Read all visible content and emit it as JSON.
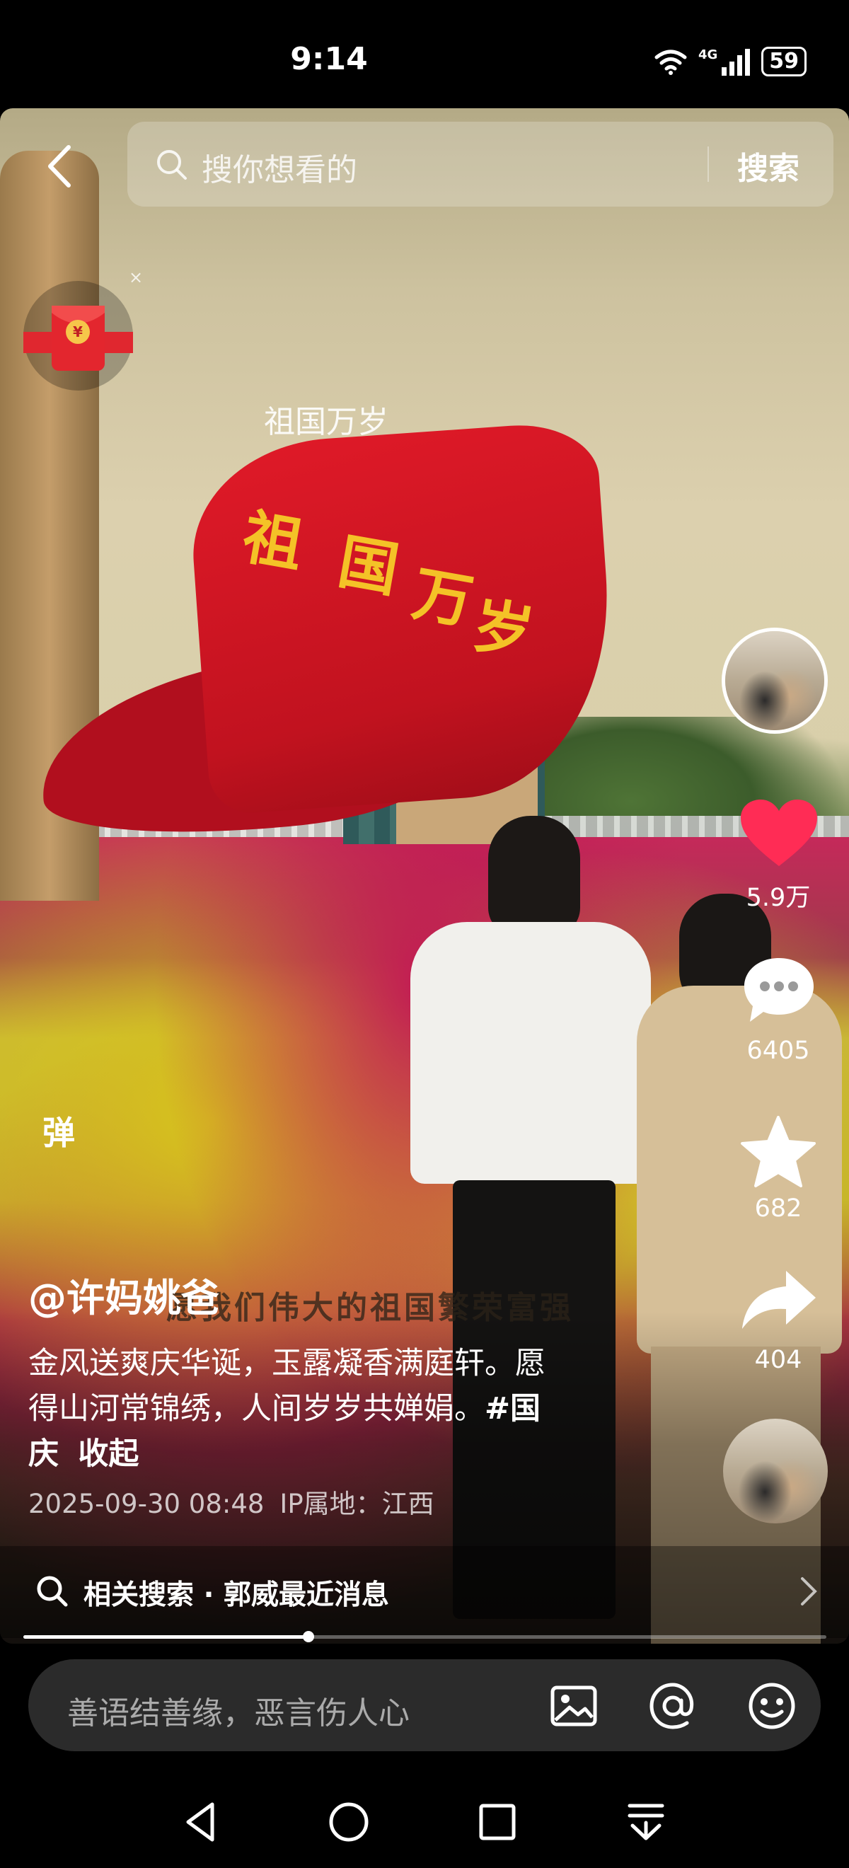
{
  "status_bar": {
    "time": "9:14",
    "network": "4G",
    "battery": "59"
  },
  "search": {
    "placeholder": "搜你想看的",
    "button_label": "搜索"
  },
  "video": {
    "danmaku_text": "祖国万岁",
    "flag_text": [
      "祖",
      "国",
      "万",
      "岁"
    ],
    "subtitle": "愿我们伟大的祖国繁荣富强"
  },
  "red_packet": {
    "symbol": "¥",
    "close": "×"
  },
  "rail": {
    "likes": "5.9万",
    "comments": "6405",
    "favorites": "682",
    "shares": "404"
  },
  "danmaku_toggle": "弹",
  "post": {
    "author": "@许妈姚爸",
    "caption_lines": [
      "金风送爽庆华诞，玉露凝香满庭轩。愿",
      "得山河常锦绣，人间岁岁共婵娟。"
    ],
    "hashtag_part1": "#国",
    "hashtag_part2": "庆",
    "collapse_label": "收起",
    "date": "2025-09-30 08:48",
    "ip_location": "IP属地：江西"
  },
  "related_search": {
    "label": "相关搜索 · 郭威最近消息"
  },
  "progress": {
    "played_fraction": 0.355
  },
  "comment_bar": {
    "placeholder": "善语结善缘，恶言伤人心"
  },
  "icons": [
    "back-icon",
    "search-icon",
    "red-packet-icon",
    "heart-icon",
    "comment-icon",
    "star-icon",
    "share-icon",
    "image-icon",
    "at-icon",
    "emoji-icon",
    "nav-back-icon",
    "nav-home-icon",
    "nav-recents-icon",
    "nav-menu-icon"
  ],
  "colors": {
    "like": "#ff2c55",
    "flag_red": "#d7192a",
    "flag_text": "#f4c227"
  }
}
